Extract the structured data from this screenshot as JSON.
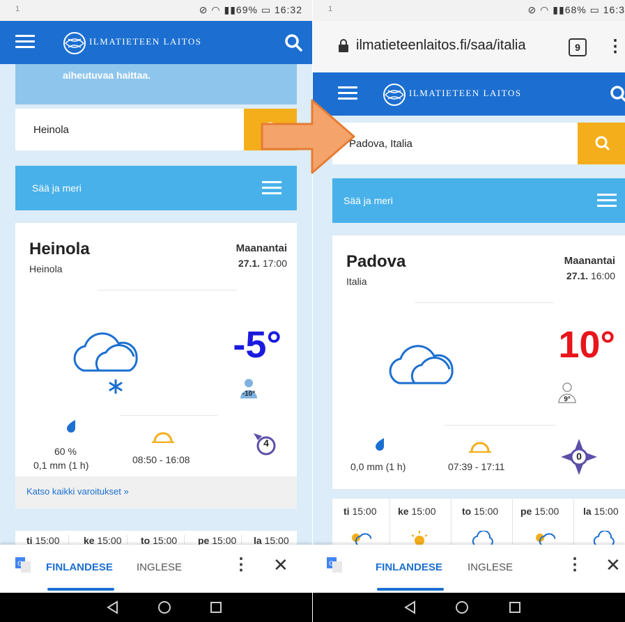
{
  "left": {
    "status": {
      "sim": "1",
      "battery": "69%",
      "time": "16:32"
    },
    "header": {
      "brand": "ILMATIETEEN LAITOS"
    },
    "banner": {
      "text": "aiheutuvaa haittaa."
    },
    "search": {
      "value": "Heinola"
    },
    "menu": {
      "label": "Sää ja meri"
    },
    "weather": {
      "place": "Heinola",
      "region": "Heinola",
      "day": "Maanantai",
      "date": "27.1.",
      "time": "17:00",
      "temperature": "-5°",
      "feels_like": "-10°",
      "precip_probability": "60 %",
      "precip_amount": "0,1 mm (1 h)",
      "sun_times": "08:50 - 16:08",
      "wind": "4",
      "icon": "cloud-snow-icon",
      "temp_color": "#1a1adf"
    },
    "warnings_link": "Katso kaikki varoitukset »",
    "forecast": [
      {
        "day": "ti",
        "time": "15:00"
      },
      {
        "day": "ke",
        "time": "15:00"
      },
      {
        "day": "to",
        "time": "15:00"
      },
      {
        "day": "pe",
        "time": "15:00"
      },
      {
        "day": "la",
        "time": "15:00"
      }
    ],
    "translate": {
      "lang_from": "FINLANDESE",
      "lang_to": "INGLESE"
    }
  },
  "right": {
    "status": {
      "sim": "1",
      "battery": "68%",
      "time": "16:3"
    },
    "url": "ilmatieteenlaitos.fi/saa/italia",
    "tab_count": "9",
    "header": {
      "brand": "ILMATIETEEN LAITOS"
    },
    "search": {
      "value": "Padova, Italia"
    },
    "menu": {
      "label": "Sää ja meri"
    },
    "weather": {
      "place": "Padova",
      "region": "Italia",
      "day": "Maanantai",
      "date": "27.1.",
      "time": "16:00",
      "temperature": "10°",
      "feels_like": "9°",
      "precip_amount": "0,0 mm (1 h)",
      "sun_times": "07:39 - 17:11",
      "wind": "0",
      "icon": "cloud-icon",
      "temp_color": "#e8151b"
    },
    "forecast": [
      {
        "day": "ti",
        "time": "15:00"
      },
      {
        "day": "ke",
        "time": "15:00"
      },
      {
        "day": "to",
        "time": "15:00"
      },
      {
        "day": "pe",
        "time": "15:00"
      },
      {
        "day": "la",
        "time": "15:00"
      }
    ],
    "translate": {
      "lang_from": "FINLANDESE",
      "lang_to": "INGLESE"
    }
  },
  "colors": {
    "brand_blue": "#1c6fd0",
    "menu_blue": "#49b1ea",
    "search_orange": "#f5ae1b",
    "arrow": "#f4a46a"
  }
}
